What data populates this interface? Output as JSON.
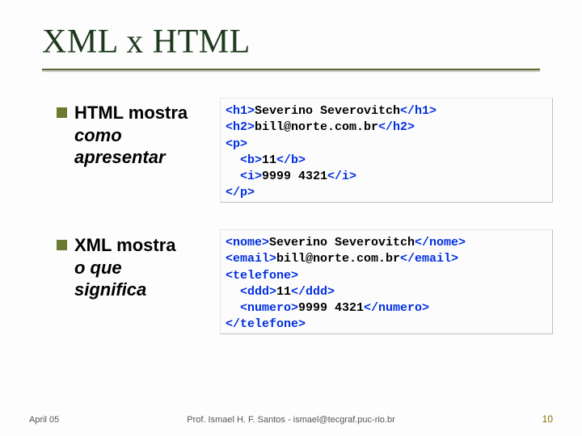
{
  "title": "XML x HTML",
  "bullet1": {
    "line1": "HTML mostra",
    "line2": "como",
    "line3": "apresentar"
  },
  "bullet2": {
    "line1": "XML mostra",
    "line2": "o que",
    "line3": "significa"
  },
  "code1": {
    "l1_tag_open": "<h1>",
    "l1_text": "Severino Severovitch",
    "l1_tag_close": "</h1>",
    "l2_tag_open": "<h2>",
    "l2_text": "bill@norte.com.br",
    "l2_tag_close": "</h2>",
    "l3_tag": "<p>",
    "l4_indent": "  ",
    "l4_tag_open": "<b>",
    "l4_text": "11",
    "l4_tag_close": "</b>",
    "l5_indent": "  ",
    "l5_tag_open": "<i>",
    "l5_text": "9999 4321",
    "l5_tag_close": "</i>",
    "l6_tag": "</p>"
  },
  "code2": {
    "l1_tag_open": "<nome>",
    "l1_text": "Severino Severovitch",
    "l1_tag_close": "</nome>",
    "l2_tag_open": "<email>",
    "l2_text": "bill@norte.com.br",
    "l2_tag_close": "</email>",
    "l3_tag": "<telefone>",
    "l4_indent": "  ",
    "l4_tag_open": "<ddd>",
    "l4_text": "11",
    "l4_tag_close": "</ddd>",
    "l5_indent": "  ",
    "l5_tag_open": "<numero>",
    "l5_text": "9999 4321",
    "l5_tag_close": "</numero>",
    "l6_tag": "</telefone>"
  },
  "footer": {
    "left": "April 05",
    "center": "Prof. Ismael H. F. Santos -  ismael@tecgraf.puc-rio.br",
    "right": "10"
  }
}
